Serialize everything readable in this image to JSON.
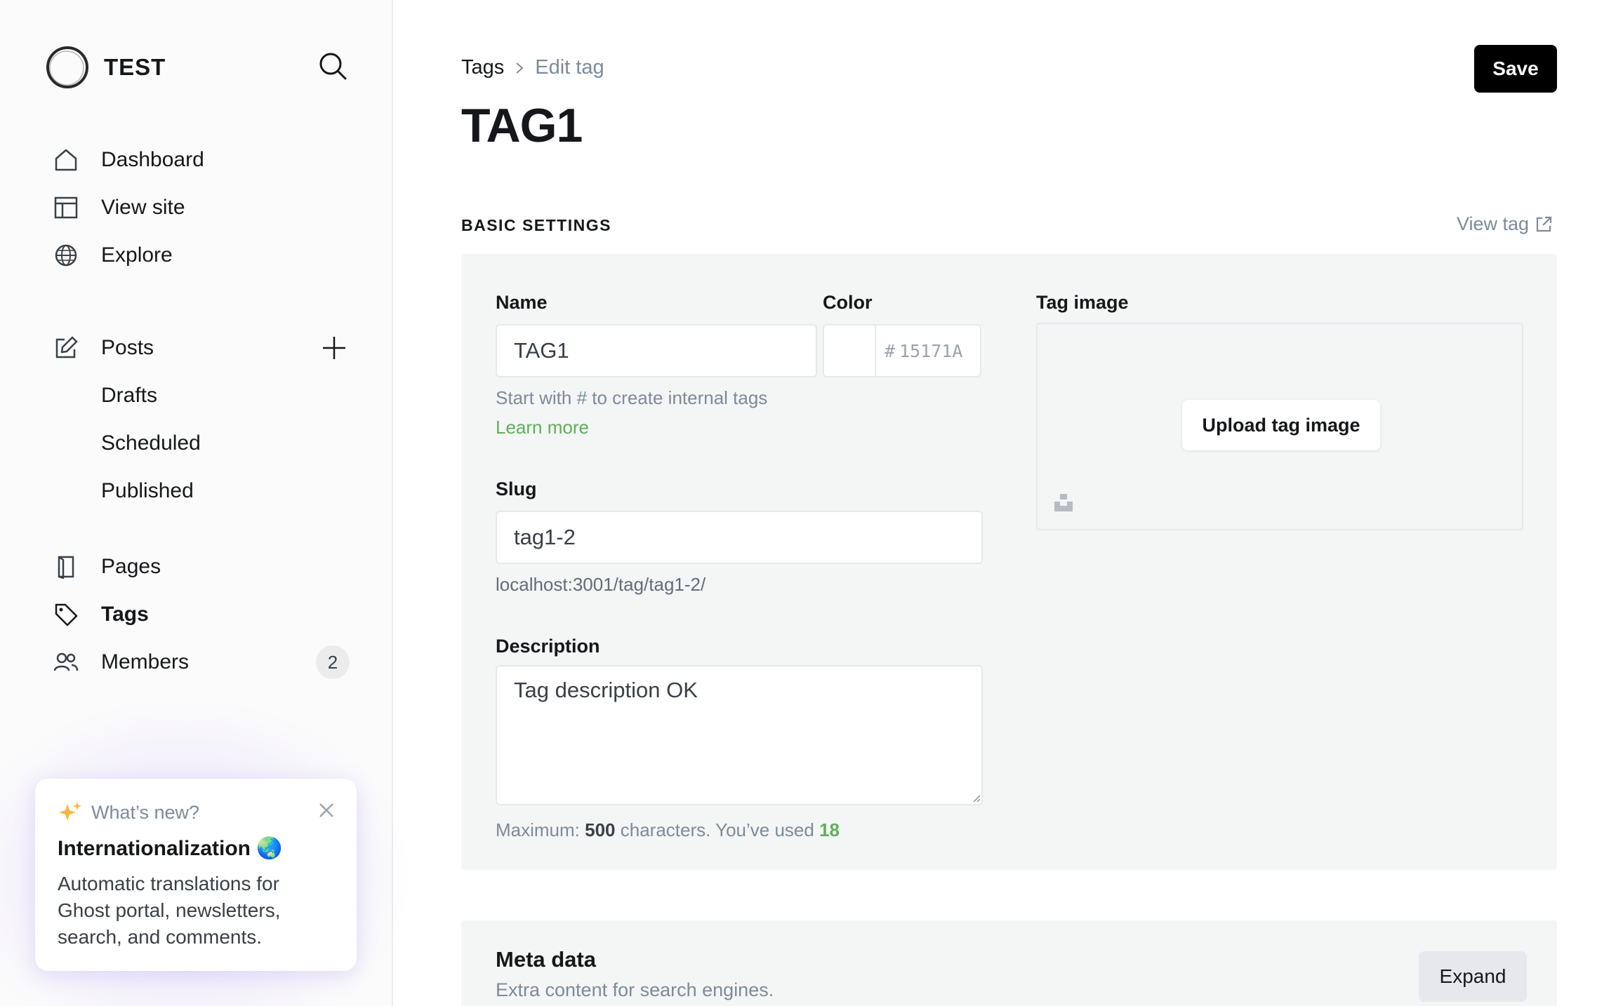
{
  "sidebar": {
    "brand": "TEST",
    "nav": [
      {
        "label": "Dashboard",
        "icon": "home-icon"
      },
      {
        "label": "View site",
        "icon": "layout-icon"
      },
      {
        "label": "Explore",
        "icon": "globe-icon"
      }
    ],
    "posts": {
      "label": "Posts",
      "subitems": [
        "Drafts",
        "Scheduled",
        "Published"
      ]
    },
    "pages": "Pages",
    "tags": "Tags",
    "members": {
      "label": "Members",
      "count": "2"
    },
    "whats_new": {
      "kicker": "What’s new?",
      "title": "Internationalization 🌏",
      "text": "Automatic translations for Ghost portal, newsletters, search, and comments."
    }
  },
  "header": {
    "breadcrumb_parent": "Tags",
    "breadcrumb_current": "Edit tag",
    "title": "TAG1",
    "save": "Save"
  },
  "basic_settings": {
    "section_label": "BASIC SETTINGS",
    "view_tag": "View tag",
    "name_label": "Name",
    "name_value": "TAG1",
    "name_hint": "Start with # to create internal tags",
    "learn_more": "Learn more",
    "color_label": "Color",
    "color_hash": "#",
    "color_placeholder": "15171A",
    "slug_label": "Slug",
    "slug_value": "tag1-2",
    "slug_url": "localhost:3001/tag/tag1-2/",
    "description_label": "Description",
    "description_value": "Tag description OK",
    "counter_prefix": "Maximum:",
    "counter_max": "500",
    "counter_mid": "characters. You’ve used",
    "counter_used": "18",
    "image_label": "Tag image",
    "upload_label": "Upload tag image"
  },
  "meta": {
    "title": "Meta data",
    "subtitle": "Extra content for search engines.",
    "expand": "Expand"
  },
  "colors": {
    "accent_green": "#5db158",
    "save_bg": "#000000",
    "panel_bg": "#f4f5f5"
  }
}
